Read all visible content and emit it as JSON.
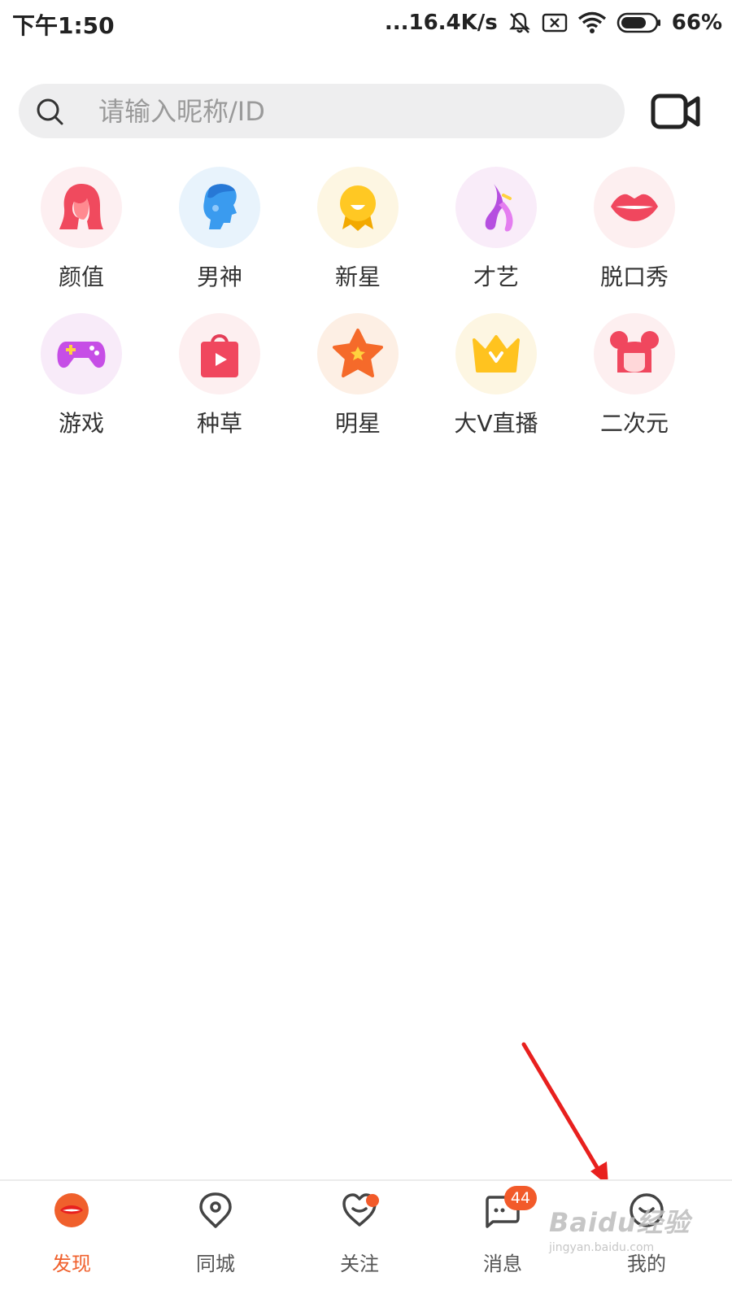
{
  "status_bar": {
    "time": "下午1:50",
    "speed": "...16.4K/s",
    "battery": "66%"
  },
  "search": {
    "placeholder": "请输入昵称/ID"
  },
  "categories": [
    {
      "label": "颜值",
      "icon": "face-woman-icon",
      "bg": "#fdeff1"
    },
    {
      "label": "男神",
      "icon": "face-man-icon",
      "bg": "#e8f3fc"
    },
    {
      "label": "新星",
      "icon": "new-star-icon",
      "bg": "#fdf6e2"
    },
    {
      "label": "才艺",
      "icon": "dance-shoe-icon",
      "bg": "#f9ecf9"
    },
    {
      "label": "脱口秀",
      "icon": "lips-icon",
      "bg": "#fdeff0"
    },
    {
      "label": "游戏",
      "icon": "gamepad-icon",
      "bg": "#f8ebf9"
    },
    {
      "label": "种草",
      "icon": "shopping-bag-icon",
      "bg": "#fdeff0"
    },
    {
      "label": "明星",
      "icon": "star-icon",
      "bg": "#fdefe4"
    },
    {
      "label": "大V直播",
      "icon": "crown-icon",
      "bg": "#fdf6e2"
    },
    {
      "label": "二次元",
      "icon": "anime-girl-icon",
      "bg": "#fdeff0"
    }
  ],
  "bottom_nav": [
    {
      "label": "发现",
      "icon": "discover-icon",
      "active": true
    },
    {
      "label": "同城",
      "icon": "location-pin-icon",
      "active": false
    },
    {
      "label": "关注",
      "icon": "heart-icon",
      "active": false
    },
    {
      "label": "消息",
      "icon": "message-icon",
      "active": false
    },
    {
      "label": "我的",
      "icon": "profile-icon",
      "active": false
    }
  ],
  "message_badge": "44",
  "watermark": {
    "main": "Baidu经验",
    "sub": "jingyan.baidu.com"
  },
  "colors": {
    "accent": "#f0602c",
    "badge": "#f25a2a",
    "arrow": "#e8201e"
  }
}
